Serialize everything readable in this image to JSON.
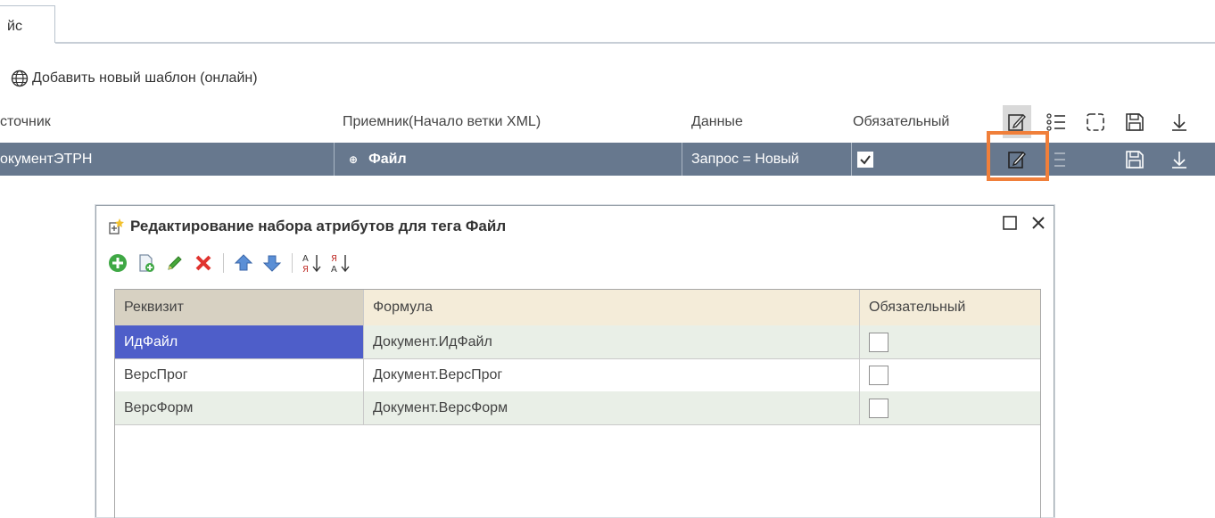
{
  "tabs": {
    "active_label": "йс"
  },
  "add_template_link": "Добавить новый шаблон (онлайн)",
  "grid": {
    "headers": {
      "source": "сточник",
      "receiver": "Приемник(Начало ветки XML)",
      "data": "Данные",
      "required": "Обязательный"
    },
    "row": {
      "source": "окументЭТРН",
      "receiver": "Файл",
      "data": "Запрос = Новый",
      "required": true
    }
  },
  "dialog": {
    "title": "Редактирование набора атрибутов для тега Файл",
    "toolbar_icons": [
      "add-icon",
      "copy-icon",
      "edit-icon",
      "delete-icon",
      "move-up-icon",
      "move-down-icon",
      "sort-asc-icon",
      "sort-desc-icon"
    ],
    "table": {
      "headers": {
        "attribute": "Реквизит",
        "formula": "Формула",
        "required": "Обязательный"
      },
      "rows": [
        {
          "attribute": "ИдФайл",
          "formula": "Документ.ИдФайл",
          "required": false
        },
        {
          "attribute": "ВерсПрог",
          "formula": "Документ.ВерсПрог",
          "required": false
        },
        {
          "attribute": "ВерсФорм",
          "formula": "Документ.ВерсФорм",
          "required": false
        }
      ]
    }
  },
  "colors": {
    "selected_row": "#67788e",
    "highlight": "#f07f3a",
    "selected_cell": "#4e5ec9"
  }
}
